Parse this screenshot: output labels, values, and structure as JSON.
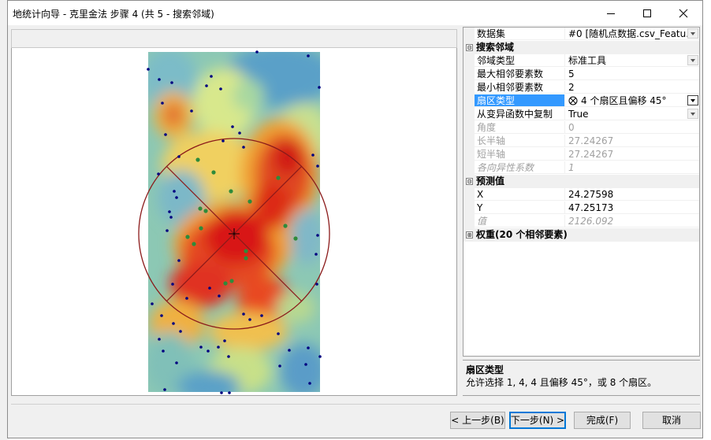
{
  "window": {
    "title": "地统计向导 - 克里金法 步骤 4 (共 5 - 搜索邻域)"
  },
  "properties": {
    "dataset": {
      "name": "数据集",
      "value": "#0 [随机点数据.csv_Featu..."
    },
    "search_neighborhood": {
      "category": "搜索邻域",
      "toggle": "⊟",
      "rows": [
        {
          "name": "邻域类型",
          "value": "标准工具"
        },
        {
          "name": "最大相邻要素数",
          "value": "5"
        },
        {
          "name": "最小相邻要素数",
          "value": "2"
        },
        {
          "name": "扇区类型",
          "value": "4 个扇区且偏移 45°"
        },
        {
          "name": "从变异函数中复制",
          "value": "True"
        },
        {
          "name": "角度",
          "value": "0"
        },
        {
          "name": "长半轴",
          "value": "27.24267"
        },
        {
          "name": "短半轴",
          "value": "27.24267"
        },
        {
          "name": "各向异性系数",
          "value": "1"
        }
      ]
    },
    "prediction": {
      "category": "预测值",
      "toggle": "⊟",
      "rows": [
        {
          "name": "X",
          "value": "24.27598"
        },
        {
          "name": "Y",
          "value": "47.25173"
        },
        {
          "name": "值",
          "value": "2126.092"
        }
      ]
    },
    "weights": {
      "category": "权重(20 个相邻要素)",
      "toggle": "⊞"
    }
  },
  "help": {
    "title": "扇区类型",
    "text": "允许选择 1, 4, 4 且偏移 45°，或 8 个扇区。"
  },
  "buttons": {
    "back": "< 上一步(B)",
    "next": "下一步(N) >",
    "finish": "完成(F)",
    "cancel": "取消"
  },
  "colors": {
    "selection": "#3399ff",
    "circle": "#8b1a1a",
    "point_outside": "#000080",
    "point_neighbor": "#2e8b3a"
  },
  "icons": {
    "sector": "sector-crossed-circle-icon",
    "crosshair": "crosshair-icon"
  }
}
